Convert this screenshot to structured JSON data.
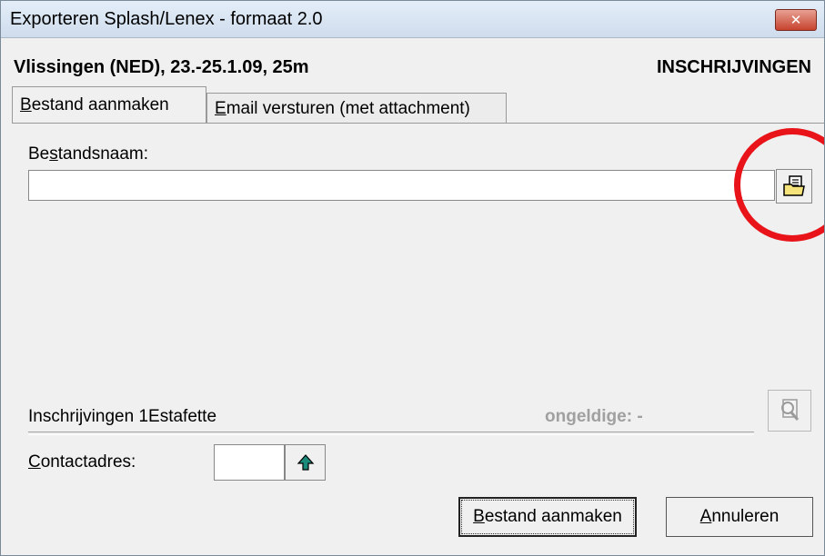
{
  "window": {
    "title": "Exporteren Splash/Lenex - formaat 2.0"
  },
  "header": {
    "meet": "Vlissingen (NED), 23.-25.1.09, 25m",
    "type": "INSCHRIJVINGEN"
  },
  "tabs": [
    {
      "label": "Bestand aanmaken",
      "mnemonic": "B",
      "rest": "estand aanmaken",
      "active": true
    },
    {
      "label": "Email versturen (met attachment)",
      "mnemonic": "E",
      "rest": "mail versturen (met attachment)",
      "active": false
    }
  ],
  "file": {
    "label_pre": "Be",
    "label_mnemonic": "s",
    "label_post": "tandsnaam:",
    "value": ""
  },
  "entries": {
    "label": "Inschrijvingen 1Estafette",
    "invalid": "ongeldige: -"
  },
  "contact": {
    "label_mnemonic": "C",
    "label_rest": "ontactadres:",
    "value": ""
  },
  "buttons": {
    "create": {
      "mnemonic": "B",
      "rest": "estand aanmaken"
    },
    "cancel": {
      "mnemonic": "A",
      "rest": "nnuleren"
    }
  },
  "colors": {
    "highlight_circle": "#e8141a",
    "title_bar": "#dbe6f3",
    "close_button": "#c7432f"
  },
  "icons": {
    "browse": "folder-document-icon",
    "search": "magnifier-document-icon",
    "up": "arrow-up-icon",
    "close": "close-icon"
  }
}
